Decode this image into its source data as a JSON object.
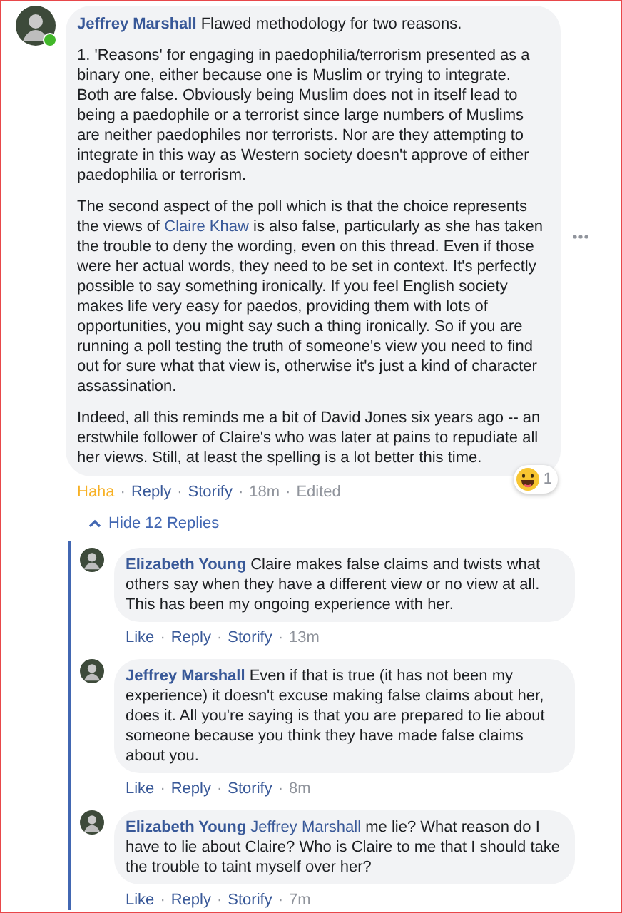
{
  "comment": {
    "author": "Jeffrey Marshall",
    "online": true,
    "paragraphs": [
      [
        {
          "kind": "text",
          "text": "Flawed methodology for two reasons."
        }
      ],
      [
        {
          "kind": "text",
          "text": "1. 'Reasons' for engaging in paedophilia/terrorism presented as a binary one, either because one is Muslim or trying to integrate. Both are false. Obviously being Muslim does not in itself lead to being a paedophile or a terrorist since large numbers of Muslims are neither paedophiles nor terrorists. Nor are they attempting to integrate in this way as Western society doesn't approve of either paedophilia or terrorism."
        }
      ],
      [
        {
          "kind": "text",
          "text": "The second aspect of the poll which is that the choice represents the views of "
        },
        {
          "kind": "link",
          "text": "Claire Khaw"
        },
        {
          "kind": "text",
          "text": " is also false, particularly as she has taken the trouble to deny the wording, even on this thread. Even if those were her actual words, they need to be set in context. It's perfectly possible to say something ironically. If you feel English society makes life very easy for paedos, providing them with lots of opportunities, you might say such a thing ironically. So if you are running a poll testing the truth of someone's view you need to find out for sure what that view is, otherwise it's just a kind of character assassination."
        }
      ],
      [
        {
          "kind": "text",
          "text": "Indeed, all this reminds me a bit of David Jones six years ago -- an erstwhile follower of Claire's who was later at pains to repudiate all her views. Still, at least the spelling is a lot better this time."
        }
      ]
    ],
    "reaction_count": "1",
    "actions": [
      {
        "kind": "reaction",
        "text": "Haha"
      },
      {
        "kind": "link",
        "text": "Reply"
      },
      {
        "kind": "link",
        "text": "Storify"
      },
      {
        "kind": "time",
        "text": "18m"
      },
      {
        "kind": "meta",
        "text": "Edited"
      }
    ]
  },
  "separator": "·",
  "replies_toggle": {
    "label": "Hide 12 Replies",
    "expanded": true
  },
  "replies": [
    {
      "author": "Elizabeth Young",
      "paragraphs": [
        [
          {
            "kind": "text",
            "text": "Claire makes false claims and twists what others say when they have a different view or no view at all. This has been my ongoing experience with her."
          }
        ]
      ],
      "actions": [
        {
          "kind": "link",
          "text": "Like"
        },
        {
          "kind": "link",
          "text": "Reply"
        },
        {
          "kind": "link",
          "text": "Storify"
        },
        {
          "kind": "time",
          "text": "13m"
        }
      ]
    },
    {
      "author": "Jeffrey Marshall",
      "paragraphs": [
        [
          {
            "kind": "text",
            "text": "Even if that is true (it has not been my experience) it doesn't excuse making false claims about her, does it. All you're saying is that you are prepared to lie about someone because you think they have made false claims about you."
          }
        ]
      ],
      "actions": [
        {
          "kind": "link",
          "text": "Like"
        },
        {
          "kind": "link",
          "text": "Reply"
        },
        {
          "kind": "link",
          "text": "Storify"
        },
        {
          "kind": "time",
          "text": "8m"
        }
      ]
    },
    {
      "author": "Elizabeth Young",
      "paragraphs": [
        [
          {
            "kind": "link",
            "text": "Jeffrey Marshall"
          },
          {
            "kind": "text",
            "text": " me lie? What reason do I have to lie about Claire? Who is Claire to me that I should take the trouble to taint myself over her?"
          }
        ]
      ],
      "actions": [
        {
          "kind": "link",
          "text": "Like"
        },
        {
          "kind": "link",
          "text": "Reply"
        },
        {
          "kind": "link",
          "text": "Storify"
        },
        {
          "kind": "time",
          "text": "7m"
        }
      ]
    }
  ]
}
